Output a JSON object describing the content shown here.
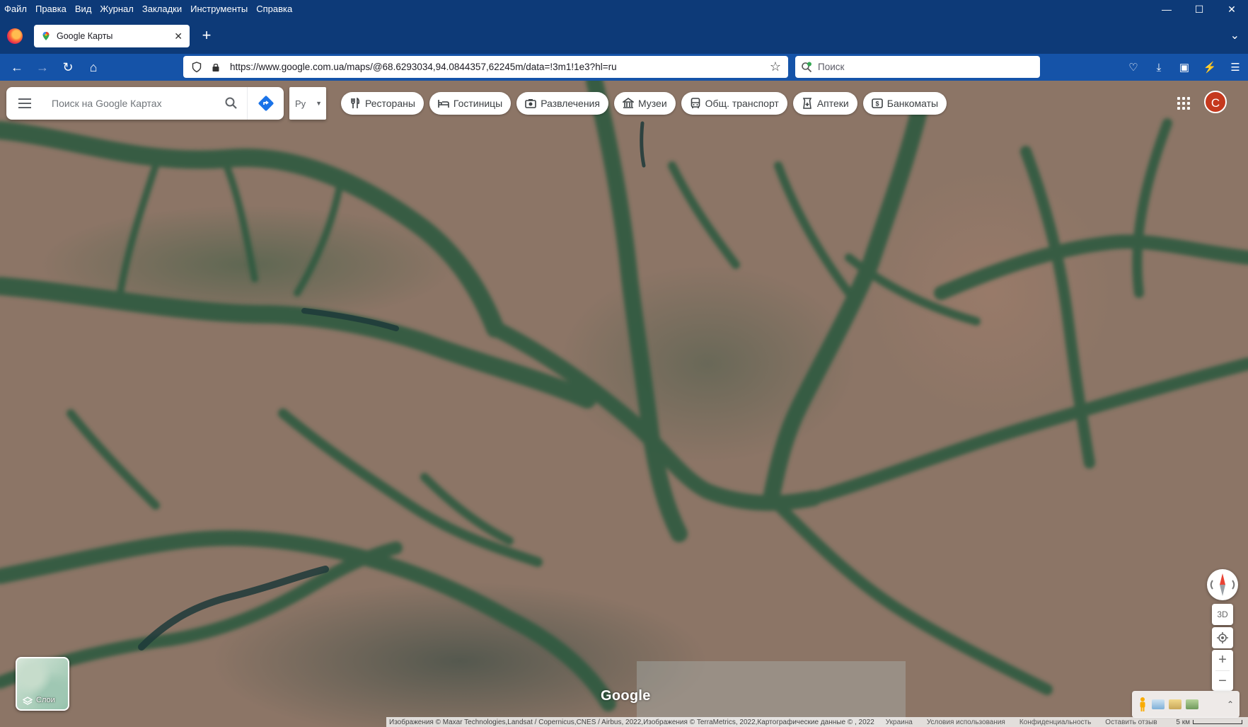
{
  "menubar": {
    "items": [
      "Файл",
      "Правка",
      "Вид",
      "Журнал",
      "Закладки",
      "Инструменты",
      "Справка"
    ]
  },
  "tab": {
    "title": "Google Карты"
  },
  "urlbar": {
    "url": "https://www.google.com.ua/maps/@68.6293034,94.0844357,62245m/data=!3m1!1e3?hl=ru"
  },
  "searchbar": {
    "placeholder": "Поиск"
  },
  "maps": {
    "search_placeholder": "Поиск на Google Картах",
    "lang_value": "Ру",
    "chips": [
      {
        "label": "Рестораны",
        "icon": "fork-knife-icon"
      },
      {
        "label": "Гостиницы",
        "icon": "bed-icon"
      },
      {
        "label": "Развлечения",
        "icon": "camera-icon"
      },
      {
        "label": "Музеи",
        "icon": "museum-icon"
      },
      {
        "label": "Общ. транспорт",
        "icon": "bus-icon"
      },
      {
        "label": "Аптеки",
        "icon": "pharmacy-icon"
      },
      {
        "label": "Банкоматы",
        "icon": "atm-icon"
      }
    ],
    "avatar_letter": "С",
    "btn_3d": "3D",
    "zoom_in": "+",
    "zoom_out": "−",
    "layers_label": "Слои",
    "logo": "Google",
    "attribution": "Изображения © Maxar Technologies,Landsat / Copernicus,CNES / Airbus, 2022,Изображения © TerraMetrics, 2022,Картографические данные © , 2022",
    "footer_links": [
      "Украина",
      "Условия использования",
      "Конфиденциальность",
      "Оставить отзыв"
    ],
    "scale_label": "5 км"
  },
  "colors": {
    "chrome": "#0d3a78",
    "navbar": "#1553a8",
    "avatar": "#c5391e",
    "terrain": "#8c7566",
    "valley": "#2f5a40"
  }
}
